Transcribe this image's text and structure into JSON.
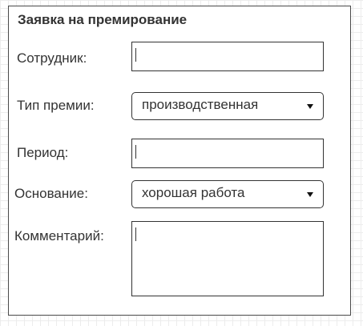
{
  "form": {
    "title": "Заявка на премирование",
    "employee": {
      "label": "Сотрудник:",
      "value": ""
    },
    "bonus_type": {
      "label": "Тип премии:",
      "selected": "производственная"
    },
    "period": {
      "label": "Период:",
      "value": ""
    },
    "reason": {
      "label": "Основание:",
      "selected": "хорошая работа"
    },
    "comment": {
      "label": "Комментарий:",
      "value": ""
    }
  },
  "icons": {
    "dropdown": "chevron-down-icon",
    "text_cursor": "text-cursor-icon"
  },
  "colors": {
    "border": "#333333",
    "text": "#333333",
    "background": "#ffffff",
    "grid": "#ececec"
  }
}
